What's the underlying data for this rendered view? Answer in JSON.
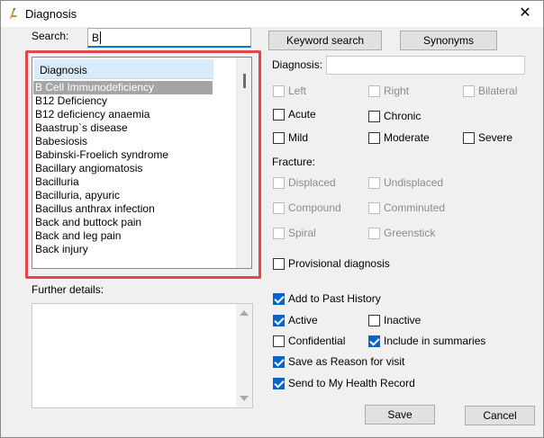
{
  "window": {
    "title": "Diagnosis",
    "close_glyph": "✕"
  },
  "search": {
    "label": "Search:",
    "value": "B"
  },
  "buttons": {
    "keyword_search": "Keyword search",
    "synonyms": "Synonyms",
    "save": "Save",
    "cancel": "Cancel"
  },
  "list": {
    "header": "Diagnosis",
    "items": [
      "B Cell Immunodeficiency",
      "B12 Deficiency",
      "B12 deficiency anaemia",
      "Baastrup`s disease",
      "Babesiosis",
      "Babinski-Froelich syndrome",
      "Bacillary angiomatosis",
      "Bacilluria",
      "Bacilluria, apyuric",
      "Bacillus anthrax infection",
      "Back and buttock pain",
      "Back and leg pain",
      "Back injury"
    ],
    "selected_index": 0
  },
  "further_details": {
    "label": "Further details:"
  },
  "diagnosis_field": {
    "label": "Diagnosis:",
    "value": ""
  },
  "laterality": {
    "left": "Left",
    "right": "Right",
    "bilateral": "Bilateral"
  },
  "severity": {
    "acute": "Acute",
    "chronic": "Chronic",
    "mild": "Mild",
    "moderate": "Moderate",
    "severe": "Severe"
  },
  "fracture": {
    "label": "Fracture:",
    "displaced": "Displaced",
    "undisplaced": "Undisplaced",
    "compound": "Compound",
    "comminuted": "Comminuted",
    "spiral": "Spiral",
    "greenstick": "Greenstick"
  },
  "options": {
    "provisional": "Provisional diagnosis",
    "add_past_history": "Add to Past History",
    "active": "Active",
    "inactive": "Inactive",
    "confidential": "Confidential",
    "include_summaries": "Include in summaries",
    "save_reason": "Save as Reason for visit",
    "send_mhr": "Send to My Health Record"
  },
  "colors": {
    "accent": "#0078d7",
    "highlight_border": "#e6434a",
    "checkbox_checked": "#0a64c8",
    "list_header_bg": "#d9ebf9",
    "selected_row_bg": "#a5a5a5"
  }
}
